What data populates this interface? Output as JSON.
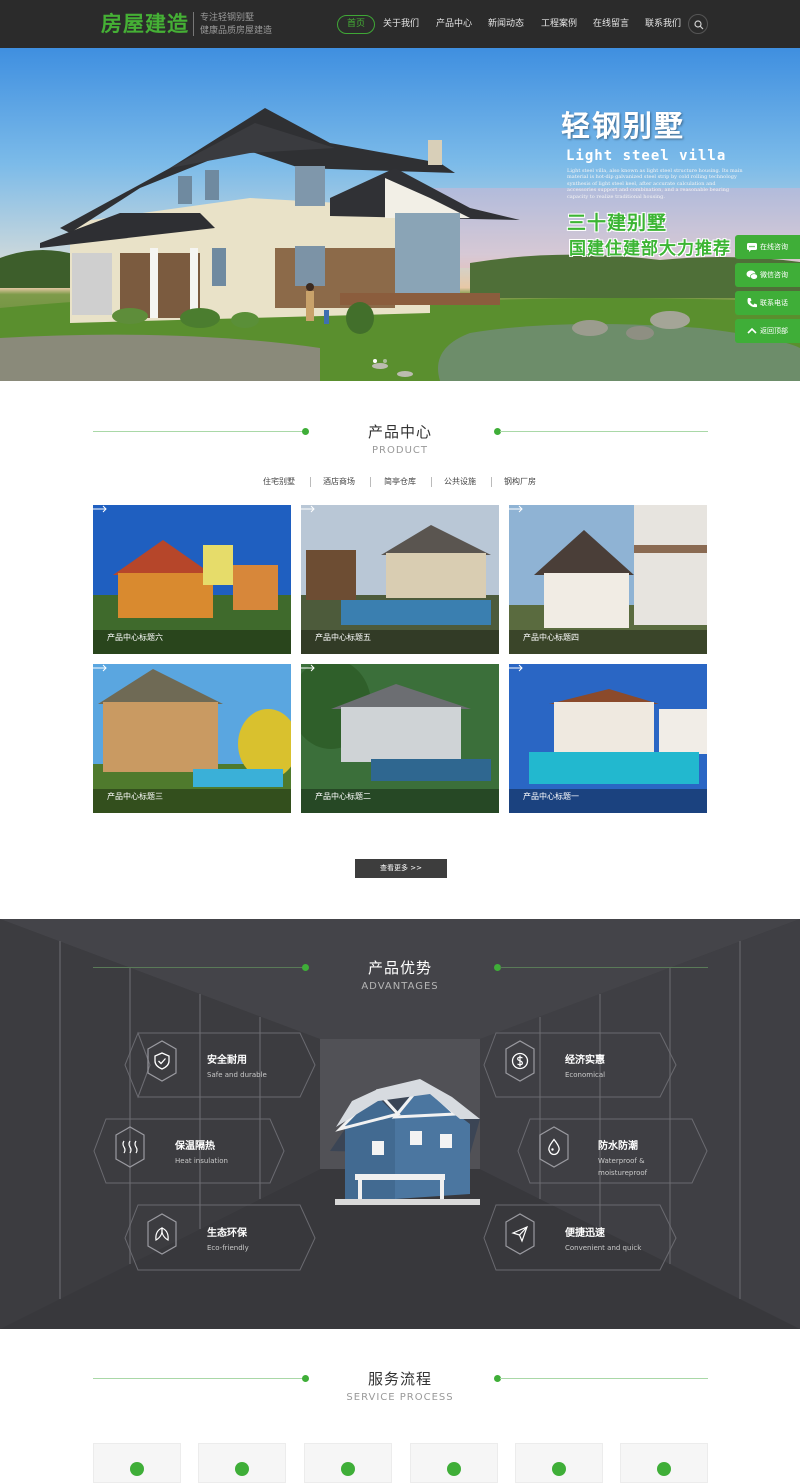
{
  "header": {
    "logo": "房屋建造",
    "slogan_line1": "专注轻钢别墅",
    "slogan_line2": "健康品质房屋建造",
    "nav": [
      "首页",
      "关于我们",
      "产品中心",
      "新闻动态",
      "工程案例",
      "在线留言",
      "联系我们"
    ],
    "active_nav": "首页",
    "search_icon": "search-icon"
  },
  "banner": {
    "title": "轻钢别墅",
    "subtitle": "Light steel villa",
    "description": "Light steel villa, also known as light steel structure housing. Its main material is hot-dip galvanized steel strip by cold rolling technology synthesis of light steel keel, after accurate calculation and accessories support and combination, and a reasonable bearing capacity to realize traditional housing.",
    "slogan1": "三十建别墅",
    "slogan2": "国建住建部大力推荐"
  },
  "float_bar": {
    "items": [
      {
        "label": "在线咨询",
        "icon": "chat-icon"
      },
      {
        "label": "微信咨询",
        "icon": "wechat-icon"
      },
      {
        "label": "联系电话",
        "icon": "phone-icon"
      },
      {
        "label": "返回顶部",
        "icon": "arrow-up-icon"
      }
    ]
  },
  "products": {
    "title_cn": "产品中心",
    "title_en": "PRODUCT",
    "categories": [
      "住宅别墅",
      "酒店商场",
      "简亭仓库",
      "公共设施",
      "钢构厂房"
    ],
    "items": [
      {
        "label": "产品中心标题六"
      },
      {
        "label": "产品中心标题五"
      },
      {
        "label": "产品中心标题四"
      },
      {
        "label": "产品中心标题三"
      },
      {
        "label": "产品中心标题二"
      },
      {
        "label": "产品中心标题一"
      }
    ],
    "more_label": "查看更多 >>"
  },
  "advantages": {
    "title_cn": "产品优势",
    "title_en": "ADVANTAGES",
    "items": [
      {
        "title": "安全耐用",
        "sub": "Safe and durable",
        "icon": "shield-check-icon"
      },
      {
        "title": "经济实惠",
        "sub": "Economical",
        "icon": "dollar-icon"
      },
      {
        "title": "保温隔热",
        "sub": "Heat insulation",
        "icon": "heat-waves-icon"
      },
      {
        "title": "防水防潮",
        "sub": "Waterproof & moistureproof",
        "icon": "water-drop-icon"
      },
      {
        "title": "生态环保",
        "sub": "Eco-friendly",
        "icon": "leaf-icon"
      },
      {
        "title": "便捷迅速",
        "sub": "Convenient and quick",
        "icon": "paper-plane-icon"
      }
    ]
  },
  "service": {
    "title_cn": "服务流程",
    "title_en": "SERVICE PROCESS"
  },
  "colors": {
    "accent": "#3fae38",
    "header_bg": "#2b2b2b",
    "advantages_bg": "#404045"
  }
}
